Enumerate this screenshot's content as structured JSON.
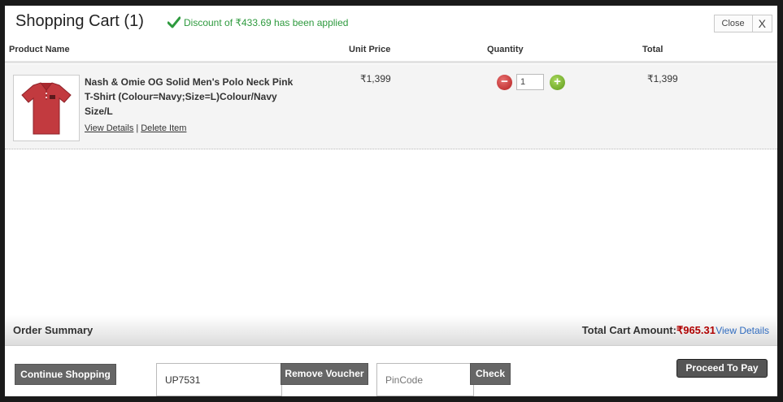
{
  "header": {
    "title": "Shopping Cart (1)",
    "discount_message": "Discount of ₹433.69 has been applied",
    "close_label": "Close",
    "x_label": "X"
  },
  "table_headers": {
    "product_name": "Product Name",
    "unit_price": "Unit Price",
    "quantity": "Quantity",
    "total": "Total"
  },
  "items": [
    {
      "name": "Nash & Omie OG Solid Men's Polo Neck Pink T-Shirt (Colour=Navy;Size=L)Colour/Navy Size/L",
      "view_details": "View Details",
      "separator": "|",
      "delete_item": "Delete Item",
      "unit_price": "₹1,399",
      "quantity": "1",
      "total": "₹1,399"
    }
  ],
  "summary": {
    "label": "Order Summary",
    "total_label": "Total Cart Amount:",
    "total_amount": "₹965.31",
    "view_details": "View Details"
  },
  "footer": {
    "continue_shopping": "Continue Shopping",
    "voucher_value": "UP7531",
    "remove_voucher": "Remove Voucher",
    "pincode_placeholder": "PinCode",
    "check": "Check",
    "proceed": "Proceed To Pay"
  },
  "colors": {
    "discount_green": "#2e9a3e",
    "amount_red": "#b00000",
    "link_blue": "#2f6bbf",
    "button_gray": "#666666"
  }
}
